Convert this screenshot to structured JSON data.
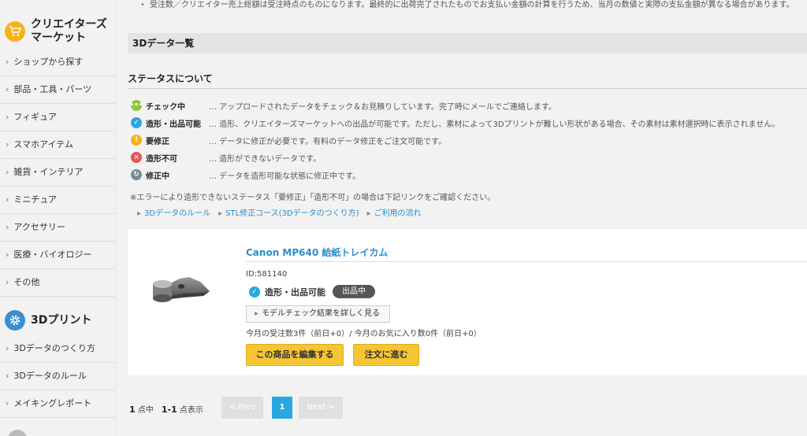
{
  "sidebar": {
    "creators_title": "クリエイターズマーケット",
    "creators_items": [
      {
        "label": "ショップから探す"
      },
      {
        "label": "部品・工具・パーツ"
      },
      {
        "label": "フィギュア"
      },
      {
        "label": "スマホアイテム"
      },
      {
        "label": "雑貨・インテリア"
      },
      {
        "label": "ミニチュア"
      },
      {
        "label": "アクセサリー"
      },
      {
        "label": "医療・バイオロジー"
      },
      {
        "label": "その他"
      }
    ],
    "print_title": "3Dプリント",
    "print_items": [
      {
        "label": "3Dデータのつくり方"
      },
      {
        "label": "3Dデータのルール"
      },
      {
        "label": "メイキングレポート"
      }
    ]
  },
  "main": {
    "top_note": "受注数／クリエイター売上総額は受注時点のものになります。最終的に出荷完了されたものでお支払い金額の計算を行うため、当月の数値と実際の支払金額が異なる場合があります。",
    "section_title": "3Dデータ一覧",
    "status_title": "ステータスについて",
    "statuses": [
      {
        "name": "チェック中",
        "desc": "… アップロードされたデータをチェック＆お見積りしています。完了時にメールでご連絡します。",
        "color": "#8cc63f",
        "icon": "dots-icon"
      },
      {
        "name": "造形・出品可能",
        "desc": "… 造形、クリエイターズマーケットへの出品が可能です。ただし、素材によって3Dプリントが難しい形状がある場合、その素材は素材選択時に表示されません。",
        "color": "#29a8e0",
        "icon": "check-icon"
      },
      {
        "name": "要修正",
        "desc": "… データに修正が必要です。有料のデータ修正をご注文可能です。",
        "color": "#f5b316",
        "icon": "exclamation-icon"
      },
      {
        "name": "造形不可",
        "desc": "… 造形ができないデータです。",
        "color": "#e8534f",
        "icon": "cross-icon"
      },
      {
        "name": "修正中",
        "desc": "… データを造形可能な状態に修正中です。",
        "color": "#7a8a96",
        "icon": "refresh-icon"
      }
    ],
    "error_note": "※エラーにより造形できないステータス「要修正」「造形不可」の場合は下記リンクをご確認ください。",
    "links": [
      {
        "label": "3Dデータのルール"
      },
      {
        "label": "STL修正コース(3Dデータのつくり方)"
      },
      {
        "label": "ご利用の流れ"
      }
    ],
    "product": {
      "title": "Canon MP640 給紙トレイカム",
      "id": "ID:581140",
      "status_label": "造形・出品可能",
      "badge": "出品中",
      "model_check": "モデルチェック結果を詳しく見る",
      "stats": "今月の受注数3件（前日+0）/ 今月のお気に入り数0件（前日+0）",
      "edit_button": "この商品を編集する",
      "order_button": "注文に進む"
    },
    "pager": {
      "total": "1",
      "total_suffix": " 点中　",
      "range": "1-1",
      "range_suffix": " 点表示",
      "prev": "< Prev",
      "current": "1",
      "next": "Next >"
    }
  }
}
